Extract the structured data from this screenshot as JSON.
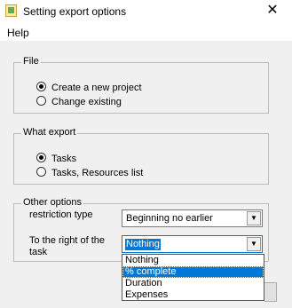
{
  "window": {
    "title": "Setting export options",
    "close_glyph": "✕",
    "icon": "app-icon"
  },
  "menu": {
    "items": [
      {
        "label": "Help"
      }
    ]
  },
  "file_group": {
    "legend": "File",
    "options": [
      {
        "label": "Create a new project",
        "checked": true
      },
      {
        "label": "Change existing",
        "checked": false
      }
    ]
  },
  "export_group": {
    "legend": "What export",
    "options": [
      {
        "label": "Tasks",
        "checked": true
      },
      {
        "label": "Tasks, Resources list",
        "checked": false
      }
    ]
  },
  "other_group": {
    "legend": "Other options",
    "restriction_label": "restriction type",
    "restriction_value": "Beginning no earlier",
    "right_label_line1": "To the right of the",
    "right_label_line2": "task",
    "right_value": "Nothing",
    "right_options": [
      {
        "label": "Nothing",
        "highlighted": false
      },
      {
        "label": "% complete",
        "highlighted": true
      },
      {
        "label": "Duration",
        "highlighted": false
      },
      {
        "label": "Expenses",
        "highlighted": false
      }
    ]
  },
  "colors": {
    "selection": "#0078d7",
    "background": "#f0f0f0"
  }
}
